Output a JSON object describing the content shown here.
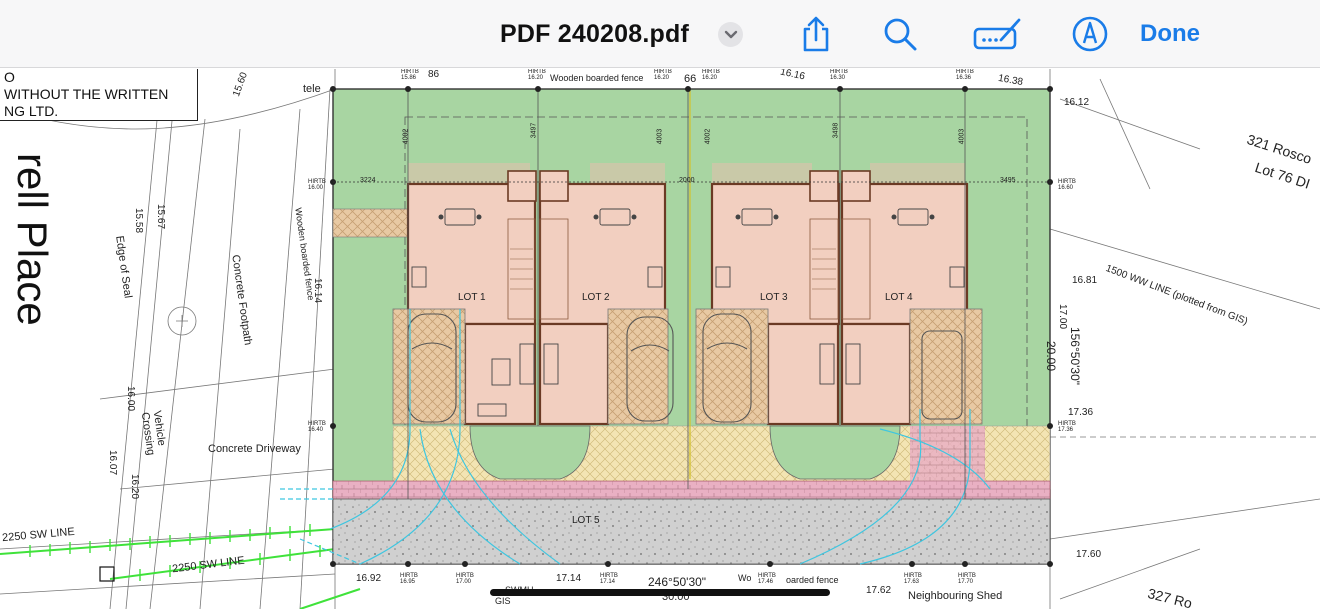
{
  "toolbar": {
    "title": "PDF 240208.pdf",
    "done_label": "Done",
    "accent": "#1a7ce8"
  },
  "notice": {
    "line1": "O",
    "line2": "WITHOUT THE WRITTEN",
    "line3": "NG LTD."
  },
  "street": {
    "name": "rell Place"
  },
  "lots": [
    "LOT 1",
    "LOT 2",
    "LOT 3",
    "LOT 4",
    "LOT 5"
  ],
  "labels": {
    "fence_top": "Wooden boarded fence",
    "fence_side": "Wooden boarded fence",
    "fence_bottom_a": "Wo",
    "fence_bottom_b": "oarded fence",
    "edge_of_seal": "Edge of Seal",
    "concrete_footpath": "Concrete Footpath",
    "vehicle_crossing_a": "Vehicle",
    "vehicle_crossing_b": "Crossing",
    "concrete_driveway": "Concrete Driveway",
    "sw_line_a": "2250 SW LINE",
    "sw_line_b": "2250 SW LINE",
    "ww_line": "1500 WW LINE (plotted from GIS)",
    "neighbour_a": "321 Rosco",
    "neighbour_b": "Lot 76 DI",
    "neighbour_c": "327 Ro",
    "neighbouring_shed": "Neighbouring Shed",
    "bearing_bottom": "246°50'30\"",
    "dist_bottom": "30.00",
    "bearing_right": "156°50'30\"",
    "dist_right": "20.00",
    "tele": "tele",
    "smh": "SWMH",
    "gis": "GIS"
  },
  "levels": {
    "l1560": "15.60",
    "l1586": "86",
    "l1616": "16.16",
    "l1638": "16.38",
    "l1612": "16.12",
    "l1681": "16.81",
    "l1700": "17.00",
    "l1736": "17.36",
    "l1760": "17.60",
    "l1762": "17.62",
    "l1714": "17.14",
    "l1692": "16.92",
    "l1558": "15.58",
    "l1567": "15.67",
    "l1614": "16.14",
    "l1600": "16.00",
    "l1607": "16.07",
    "l1620": "16.20",
    "l66": "66"
  },
  "dims": {
    "d3224": "3224",
    "d2000": "2000",
    "d3495": "3495",
    "d4002a": "4002",
    "d3497": "3497",
    "d4003a": "4003",
    "d4002b": "4002",
    "d3498": "3498",
    "d4003b": "4003"
  },
  "hirtb": {
    "label": "HIRTB",
    "h1586": "15.86",
    "h1620a": "16.20",
    "h1620b": "16.20",
    "h1620c": "16.20",
    "h1630": "16.30",
    "h1636": "16.36",
    "h1600": "16.00",
    "h1660": "16.60",
    "h1640": "16.40",
    "h1736": "17.36",
    "h1695": "16.95",
    "h1700": "17.00",
    "h1714": "17.14",
    "h1746": "17.46",
    "h1763": "17.63",
    "h1770": "17.70"
  },
  "colors": {
    "lawn": "#a8d5a2",
    "floor": "#f2cfc0",
    "paving": "#e3c39b",
    "driveway_pink": "#e8aac0",
    "concrete": "#cfcfcf",
    "sw_line": "#3fe23a",
    "turning_path": "#3ec6e0"
  }
}
